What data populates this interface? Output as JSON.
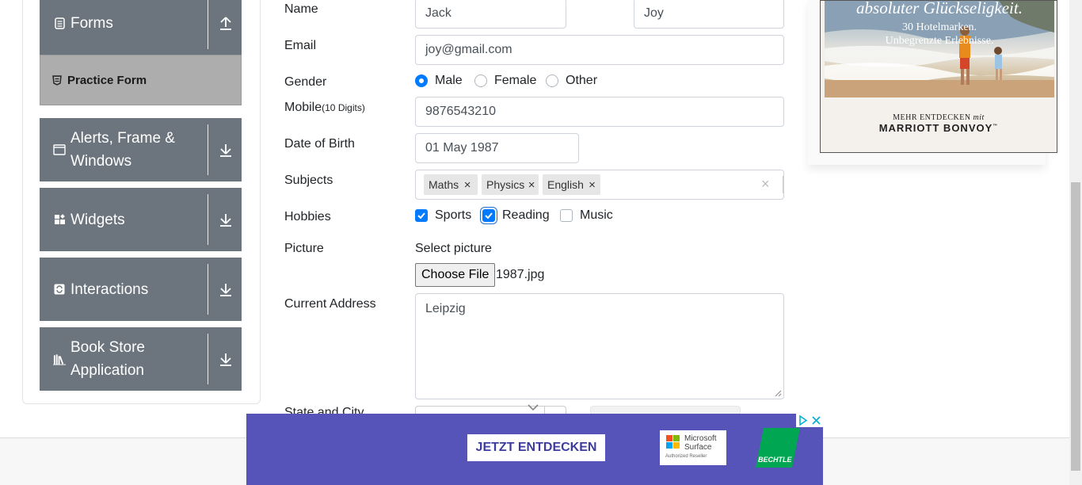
{
  "sidebar": {
    "groups": [
      {
        "title": "Forms",
        "icon": "form-icon",
        "expanded": true
      },
      {
        "title": "Alerts, Frame &",
        "title2": "Windows",
        "icon": "window-icon"
      },
      {
        "title": "Widgets",
        "icon": "widgets-icon"
      },
      {
        "title": "Interactions",
        "icon": "interactions-icon"
      },
      {
        "title": "Book Store",
        "title2": "Application",
        "icon": "book-icon"
      }
    ],
    "active_item": "Practice Form"
  },
  "form": {
    "name_label": "Name",
    "first_name": "Jack",
    "last_name": "Joy",
    "email_label": "Email",
    "email": "joy@gmail.com",
    "gender_label": "Gender",
    "gender_options": [
      "Male",
      "Female",
      "Other"
    ],
    "gender_selected": "Male",
    "mobile_label": "Mobile",
    "mobile_hint": "(10 Digits)",
    "mobile": "9876543210",
    "dob_label": "Date of Birth",
    "dob": "01 May 1987",
    "subjects_label": "Subjects",
    "subjects": [
      "Maths",
      "Physics",
      "English"
    ],
    "remove_glyph": "×",
    "clear_glyph": "×",
    "hobbies_label": "Hobbies",
    "hobbies": [
      {
        "label": "Sports",
        "checked": true
      },
      {
        "label": "Reading",
        "checked": true
      },
      {
        "label": "Music",
        "checked": false
      }
    ],
    "picture_label": "Picture",
    "picture_prompt": "Select picture",
    "choose_file_label": "Choose File",
    "file_name": "1987.jpg",
    "address_label": "Current Address",
    "address": "Leipzig",
    "state_city_label": "State and City"
  },
  "ad_right": {
    "headline_line1": "absoluter Glückseligkeit.",
    "headline_line2": "30 Hotelmarken.",
    "headline_line3": "Unbegrenzte Erlebnisse.",
    "discover_prefix": "MEHR ENTDECKEN",
    "discover_with": "mit",
    "brand": "MARRIOTT BONVOY",
    "tm": "™"
  },
  "ad_bottom": {
    "cta": "JETZT ENTDECKEN",
    "partner_line1": "Microsoft",
    "partner_line2": "Surface",
    "partner_line3": "Authorized Reseller",
    "reseller_logo": "BECHTLE",
    "background": "#5654b8"
  },
  "colors": {
    "sidebar": "#6c757d",
    "practice_item": "#adadad",
    "accent": "#007bff"
  }
}
